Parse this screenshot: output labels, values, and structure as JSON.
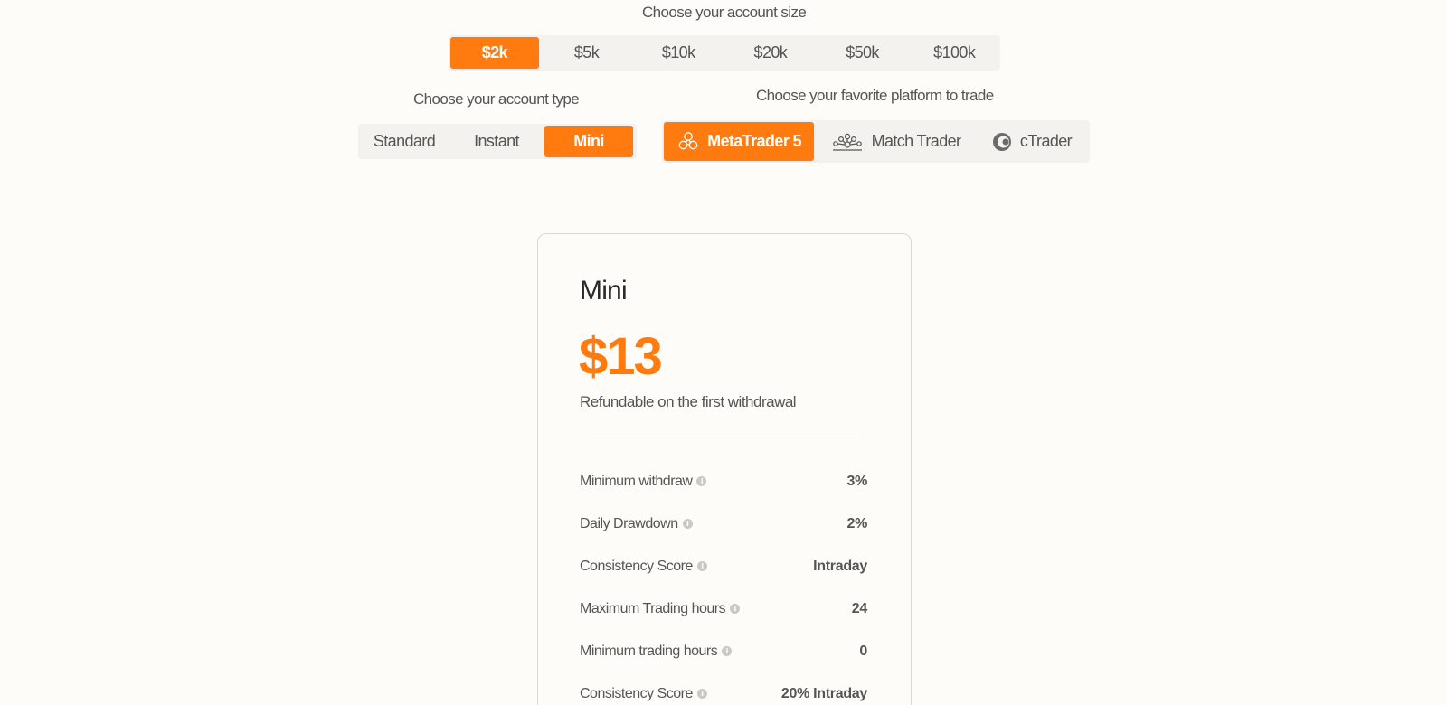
{
  "account_size": {
    "label": "Choose your account size",
    "options": [
      "$2k",
      "$5k",
      "$10k",
      "$20k",
      "$50k",
      "$100k"
    ],
    "selected": "$2k"
  },
  "account_type": {
    "label": "Choose your account type",
    "options": [
      "Standard",
      "Instant",
      "Mini"
    ],
    "selected": "Mini"
  },
  "platform": {
    "label": "Choose your favorite platform to trade",
    "options": [
      {
        "label": "MetaTrader 5",
        "icon": "metatrader-icon"
      },
      {
        "label": "Match Trader",
        "icon": "match-trader-icon"
      },
      {
        "label": "cTrader",
        "icon": "ctrader-icon"
      }
    ],
    "selected": "MetaTrader 5"
  },
  "plan_card": {
    "title": "Mini",
    "price": "$13",
    "subtitle": "Refundable on the first withdrawal",
    "rows": [
      {
        "label": "Minimum withdraw",
        "value": "3%"
      },
      {
        "label": "Daily Drawdown",
        "value": "2%"
      },
      {
        "label": "Consistency Score",
        "value": "Intraday"
      },
      {
        "label": "Maximum Trading hours",
        "value": "24"
      },
      {
        "label": "Minimum trading hours",
        "value": "0"
      },
      {
        "label": "Consistency Score",
        "value": "20% Intraday"
      }
    ]
  },
  "colors": {
    "accent": "#ff7a0f",
    "background": "#fdfcf9",
    "segment_bg": "#f3f2ef",
    "text": "#555555"
  }
}
